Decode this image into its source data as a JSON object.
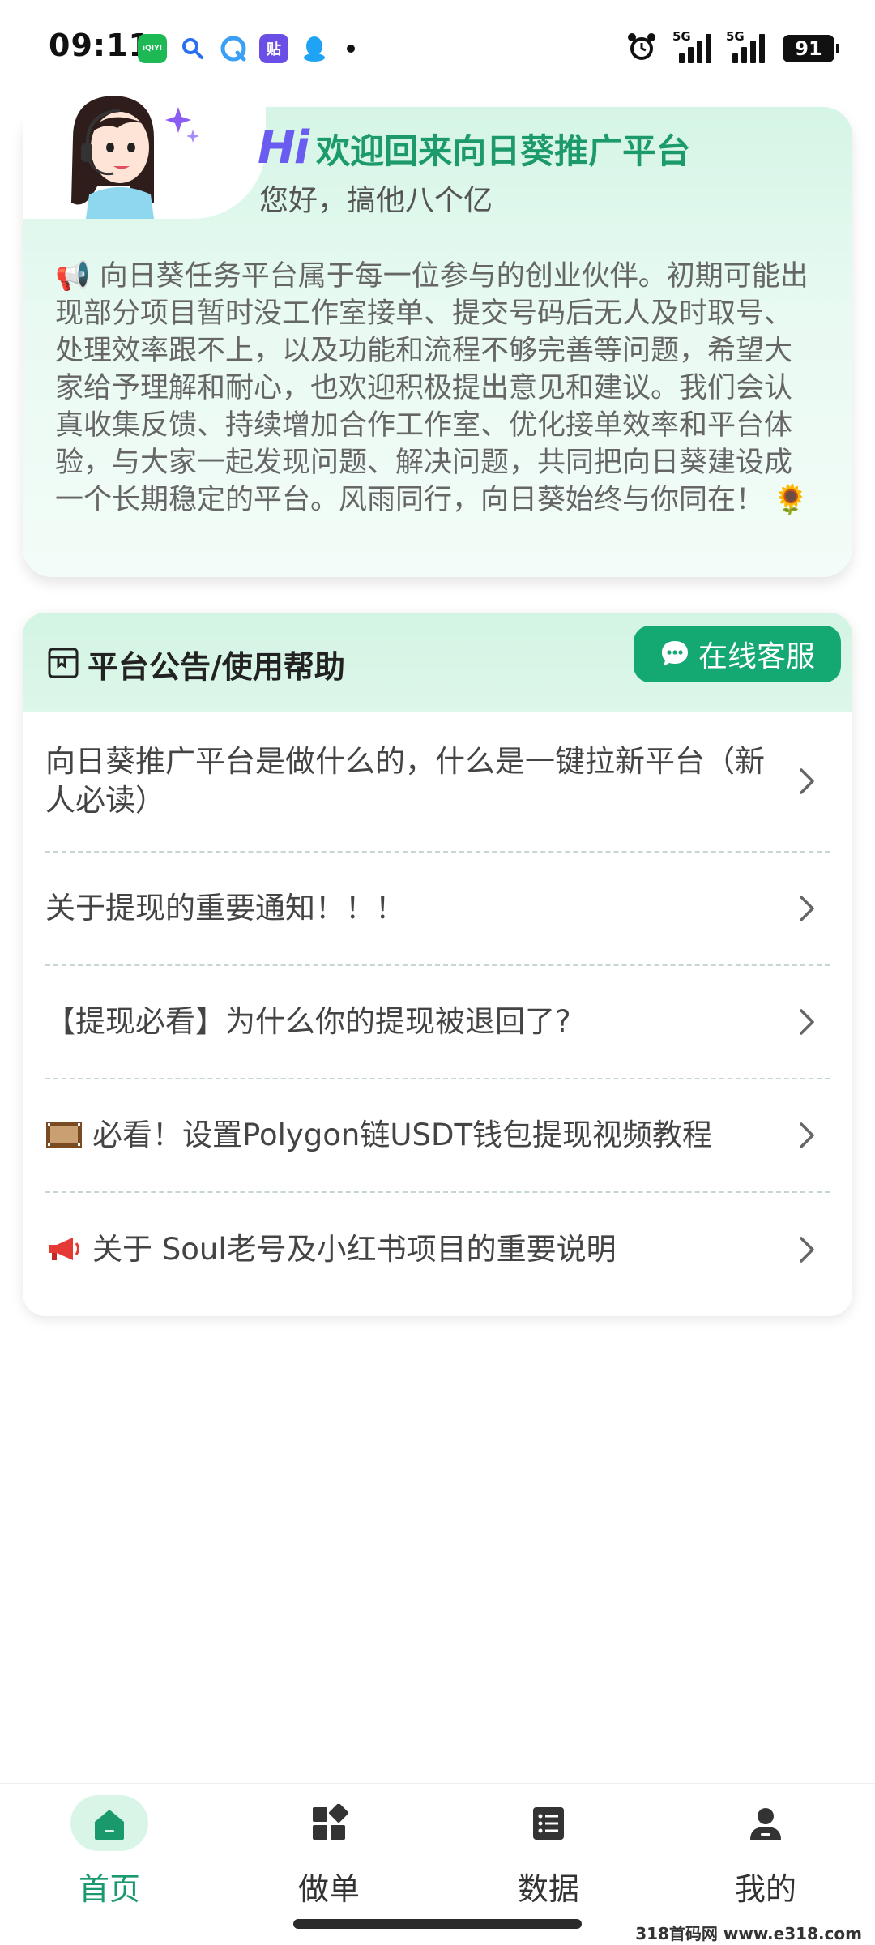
{
  "status_bar": {
    "time": "09:11",
    "notification_icons": [
      "iqiyi-icon",
      "search-icon",
      "browser-icon",
      "tieba-icon",
      "qq-icon"
    ],
    "iqiyi_label": "iQIYI",
    "tieba_label": "贴",
    "signal_1_label": "5G",
    "signal_2_label": "5G",
    "battery": "91"
  },
  "welcome": {
    "hi": "Hi",
    "title": "欢迎回来向日葵推广平台",
    "subtitle": "您好，搞他八个亿",
    "notice": "📢 向日葵任务平台属于每一位参与的创业伙伴。初期可能出现部分项目暂时没工作室接单、提交号码后无人及时取号、处理效率跟不上，以及功能和流程不够完善等问题，希望大家给予理解和耐心，也欢迎积极提出意见和建议。我们会认真收集反馈、持续增加合作工作室、优化接单效率和平台体验，与大家一起发现问题、解决问题，共同把向日葵建设成一个长期稳定的平台。风雨同行，向日葵始终与你同在！ 🌻"
  },
  "announcements": {
    "title": "平台公告/使用帮助",
    "service_button": "在线客服",
    "items": [
      {
        "text": "向日葵推广平台是做什么的，什么是一键拉新平台（新人必读）"
      },
      {
        "text": "关于提现的重要通知！！！"
      },
      {
        "text": "【提现必看】为什么你的提现被退回了?"
      },
      {
        "text": "必看！设置Polygon链USDT钱包提现视频教程",
        "icon": "film-icon"
      },
      {
        "text": "关于 Soul老号及小红书项目的重要说明",
        "icon": "megaphone-icon"
      }
    ]
  },
  "bottom_nav": {
    "items": [
      {
        "label": "首页",
        "icon": "home-icon",
        "active": true
      },
      {
        "label": "做单",
        "icon": "grid-icon",
        "active": false
      },
      {
        "label": "数据",
        "icon": "list-icon",
        "active": false
      },
      {
        "label": "我的",
        "icon": "user-icon",
        "active": false
      }
    ]
  },
  "watermark": "318首码网 www.e318.com",
  "colors": {
    "accent": "#14a873",
    "accent_text": "#1a9a6c",
    "hi_purple": "#6a5cf0",
    "card_bg": "#d5f5e6"
  }
}
